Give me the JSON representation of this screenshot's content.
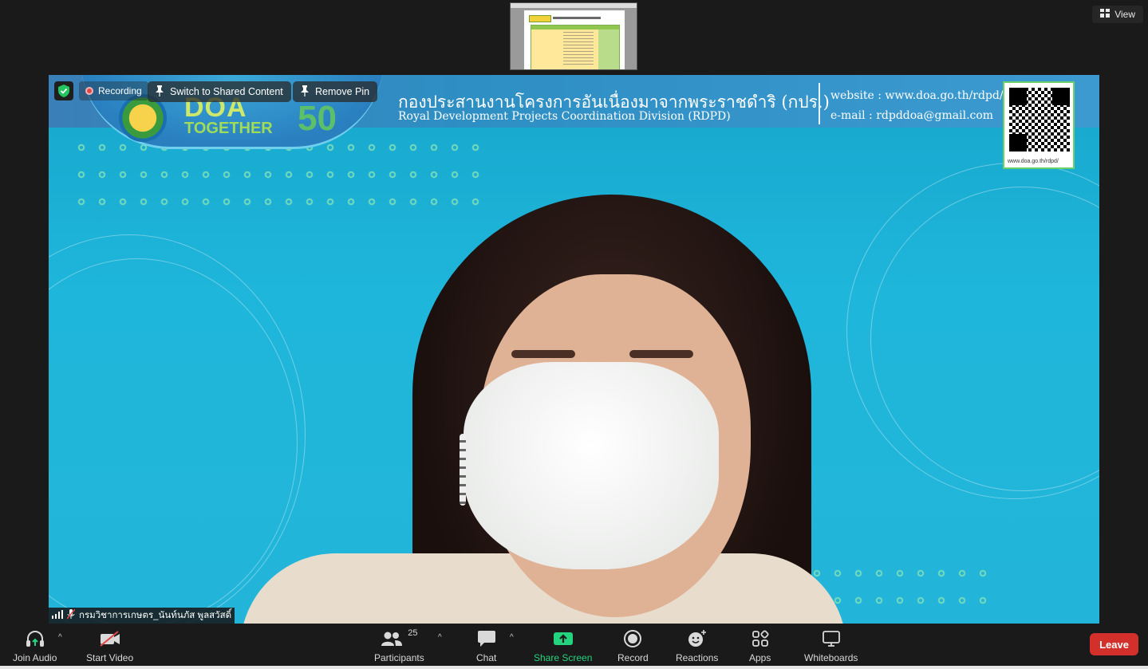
{
  "top": {
    "view_label": "View"
  },
  "video": {
    "recording_label": "Recording",
    "switch_label": "Switch to Shared Content",
    "remove_pin_label": "Remove Pin",
    "participant_name": "กรมวิชาการเกษตร_นันท์นภัส พูลสวัสดิ์",
    "banner": {
      "logo_doa": "DOA",
      "logo_together": "TOGETHER",
      "logo_fifty": "50",
      "thai_title": "กองประสานงานโครงการอันเนื่องมาจากพระราชดำริ (กปร.)",
      "eng_title": "Royal Development Projects Coordination Division (RDPD)",
      "website": "website : www.doa.go.th/rdpd/",
      "email": "e-mail : rdpddoa@gmail.com",
      "qr_url": "www.doa.go.th/rdpd/"
    }
  },
  "toolbar": {
    "join_audio": "Join Audio",
    "start_video": "Start Video",
    "participants": "Participants",
    "participants_count": "25",
    "chat": "Chat",
    "share_screen": "Share Screen",
    "record": "Record",
    "reactions": "Reactions",
    "apps": "Apps",
    "whiteboards": "Whiteboards",
    "leave": "Leave"
  },
  "colors": {
    "share_green": "#23d37d",
    "leave_red": "#d3302b",
    "toolbar_bg": "#1a1a1a"
  }
}
